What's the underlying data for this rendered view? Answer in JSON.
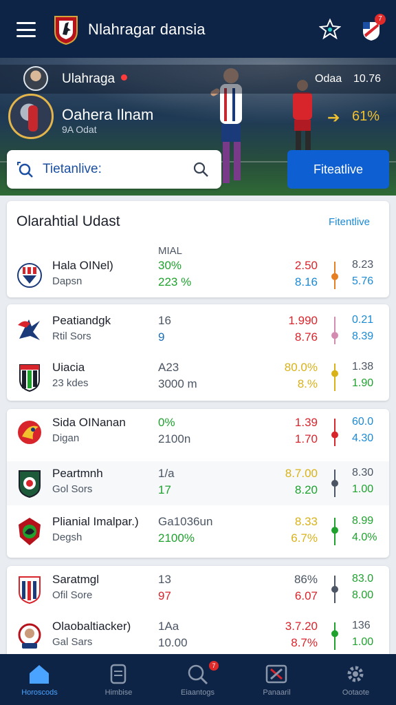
{
  "header": {
    "title": "Nlahragar dansia",
    "notification_count": "7",
    "icons": [
      "menu-icon",
      "club-logo",
      "star-icon",
      "flag-icon"
    ]
  },
  "hero": {
    "user_label": "Ulahraga",
    "stat_a": "Odaa",
    "stat_b": "10.76",
    "name": "Oahera Ilnam",
    "subtitle": "9A Odat",
    "trend_value": "61%"
  },
  "search": {
    "text": "Tietanlive:",
    "button_label": "Fiteatlive"
  },
  "cards": [
    {
      "title": "Olarahtial Udast",
      "link": "Fitentlive",
      "column_header": "MIAL",
      "rows": [
        {
          "team": "Hala OINel)",
          "sub": "Dapsn",
          "m1": "30%",
          "m2": "223 %",
          "o1": "2.50",
          "o2": "8.16",
          "v1": "8.23",
          "v2": "5.76",
          "gauge": 0.45
        }
      ]
    },
    {
      "rows": [
        {
          "team": "Peatiandgk",
          "sub": "Rtil Sors",
          "m1": "16",
          "m2": "9",
          "o1": "1.990",
          "o2": "8.76",
          "v1": "0.21",
          "v2": "8.39",
          "gauge": 0.3
        },
        {
          "team": "Uiacia",
          "sub": "23 kdes",
          "m1": "A23",
          "m2": "3000 m",
          "o1": "80.0%",
          "o2": "8.%",
          "v1": "1.38",
          "v2": "1.90",
          "gauge": 0.65
        }
      ]
    },
    {
      "rows": [
        {
          "team": "Sida OINanan",
          "sub": "Digan",
          "m1": "0%",
          "m2": "2100n",
          "o1": "1.39",
          "o2": "1.70",
          "v1": "60.0",
          "v2": "4.30",
          "gauge": 0.4
        },
        {
          "team": "Peartmnh",
          "sub": "Gol Sors",
          "m1": "1/a",
          "m2": "17",
          "o1": "8.7.00",
          "o2": "8.20",
          "v1": "8.30",
          "v2": "1.00",
          "gauge": 0.5
        },
        {
          "team": "Plianial Imalpar.)",
          "sub": "Degsh",
          "m1": "Ga1036un",
          "m2": "2100%",
          "o1": "8.33",
          "o2": "6.7%",
          "v1": "8.99",
          "v2": "4.0%",
          "gauge": 0.55
        }
      ]
    },
    {
      "rows": [
        {
          "team": "Saratmgl",
          "sub": "Ofil Sore",
          "m1": "13",
          "m2": "97",
          "o1": "86%",
          "o2": "6.07",
          "v1": "83.0",
          "v2": "8.00",
          "gauge": 0.5
        },
        {
          "team": "Olaobaltiacker)",
          "sub": "Gal Sars",
          "m1": "1Aa",
          "m2": "10.00",
          "o1": "3.7.20",
          "o2": "8.7%",
          "v1": "136",
          "v2": "1.00",
          "gauge": 0.6
        }
      ]
    }
  ],
  "bottom_nav": [
    {
      "label": "Horoscods",
      "icon": "home-icon",
      "active": true
    },
    {
      "label": "Himbise",
      "icon": "ticket-icon",
      "active": false
    },
    {
      "label": "Eiaantogs",
      "icon": "search-icon",
      "active": false,
      "badge": "7"
    },
    {
      "label": "Panaaril",
      "icon": "tools-icon",
      "active": false
    },
    {
      "label": "Ootaote",
      "icon": "settings-icon",
      "active": false
    }
  ],
  "colors": {
    "navy": "#0d2447",
    "accent_blue": "#0e5fd1",
    "green": "#1fa12e",
    "red": "#d8252c",
    "yellow": "#d9b21a",
    "link_blue": "#1a8ad6"
  }
}
